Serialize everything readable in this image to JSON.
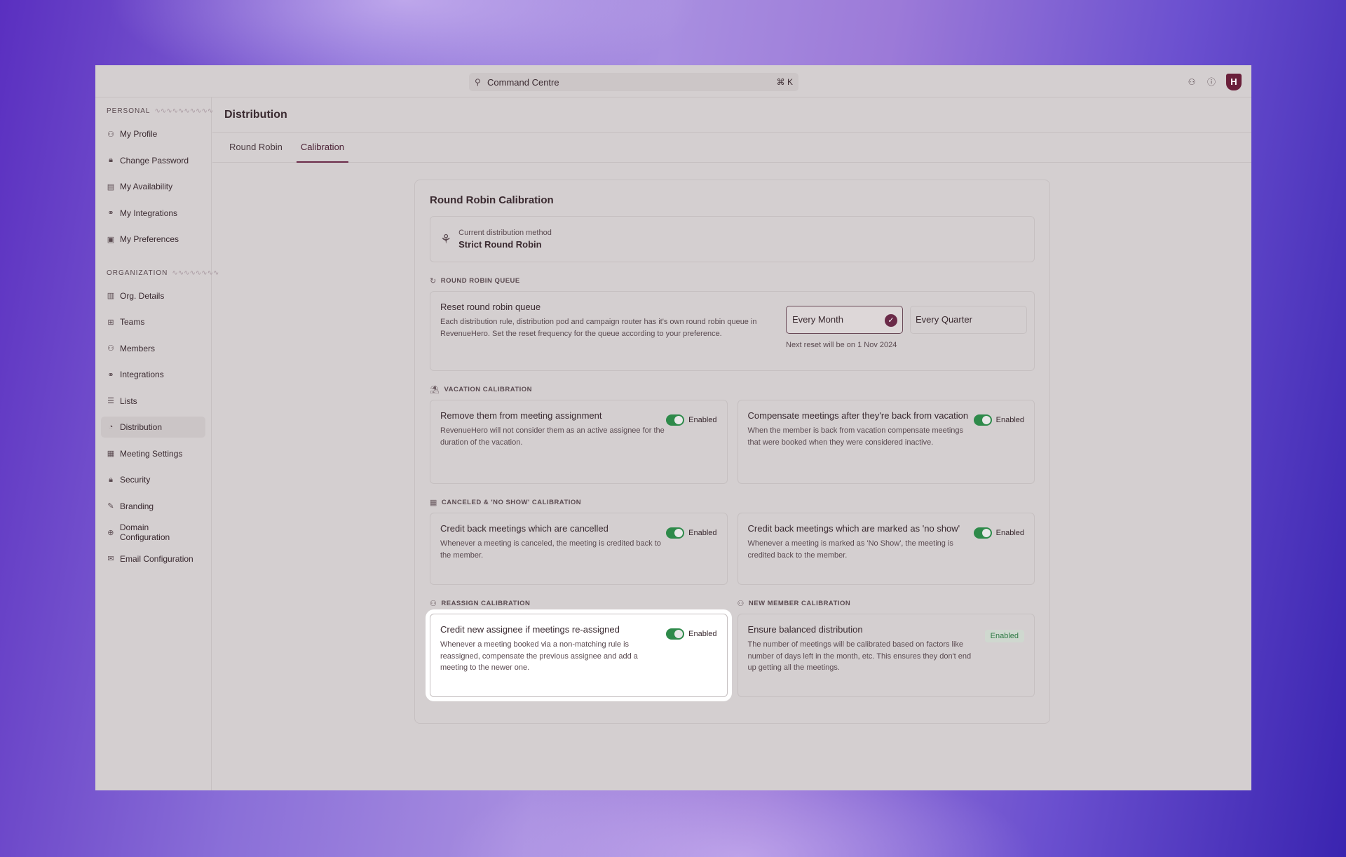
{
  "search": {
    "label": "Command Centre",
    "shortcut": "⌘ K"
  },
  "header": {
    "logo_text": "H"
  },
  "sidebar": {
    "personal_title": "PERSONAL",
    "organization_title": "ORGANIZATION",
    "personal_items": [
      {
        "label": "My Profile",
        "icon": "user-icon"
      },
      {
        "label": "Change Password",
        "icon": "lock-icon"
      },
      {
        "label": "My Availability",
        "icon": "calendar-icon"
      },
      {
        "label": "My Integrations",
        "icon": "plug-icon"
      },
      {
        "label": "My Preferences",
        "icon": "preferences-icon"
      }
    ],
    "org_items": [
      {
        "label": "Org. Details",
        "icon": "building-icon"
      },
      {
        "label": "Teams",
        "icon": "teams-icon"
      },
      {
        "label": "Members",
        "icon": "members-icon"
      },
      {
        "label": "Integrations",
        "icon": "plug-icon"
      },
      {
        "label": "Lists",
        "icon": "list-icon"
      },
      {
        "label": "Distribution",
        "icon": "distribution-icon",
        "active": true
      },
      {
        "label": "Meeting Settings",
        "icon": "meeting-icon"
      },
      {
        "label": "Security",
        "icon": "lock-icon"
      },
      {
        "label": "Branding",
        "icon": "brush-icon"
      },
      {
        "label": "Domain Configuration",
        "icon": "globe-icon"
      },
      {
        "label": "Email Configuration",
        "icon": "mail-icon"
      }
    ]
  },
  "main": {
    "title": "Distribution",
    "tabs": [
      {
        "label": "Round Robin",
        "active": false
      },
      {
        "label": "Calibration",
        "active": true
      }
    ]
  },
  "card": {
    "title": "Round Robin Calibration",
    "method_label": "Current distribution method",
    "method_value": "Strict Round Robin",
    "queue": {
      "group": "ROUND ROBIN QUEUE",
      "title": "Reset round robin queue",
      "desc": "Each distribution rule, distribution pod and campaign router has it's own round robin queue in RevenueHero. Set the reset frequency for the queue according to your preference.",
      "option_selected": "Every Month",
      "option_other": "Every Quarter",
      "next_reset": "Next reset will be on 1 Nov 2024"
    },
    "vacation": {
      "group": "VACATION CALIBRATION",
      "left_title": "Remove them from meeting assignment",
      "left_desc": "RevenueHero will not consider them as an active assignee for the duration of the vacation.",
      "left_status": "Enabled",
      "right_title": "Compensate meetings after they're back from vacation",
      "right_desc": "When the member is back from vacation compensate meetings that were booked when they were considered inactive.",
      "right_status": "Enabled"
    },
    "canceled": {
      "group": "CANCELED & 'NO SHOW' CALIBRATION",
      "left_title": "Credit back meetings which are cancelled",
      "left_desc": "Whenever a meeting is canceled, the meeting is credited back to the member.",
      "left_status": "Enabled",
      "right_title": "Credit back meetings which are marked as 'no show'",
      "right_desc": "Whenever a meeting is marked as 'No Show', the meeting is credited back to the member.",
      "right_status": "Enabled"
    },
    "reassign": {
      "group": "REASSIGN CALIBRATION",
      "title": "Credit new assignee if meetings re-assigned",
      "desc": "Whenever a meeting booked via a non-matching rule is reassigned, compensate the previous assignee and add a meeting to the newer one.",
      "status": "Enabled"
    },
    "new_member": {
      "group": "NEW MEMBER CALIBRATION",
      "title": "Ensure balanced distribution",
      "desc": "The number of meetings will be calibrated based on factors like number of days left in the month, etc. This ensures they don't end up getting all the meetings.",
      "status": "Enabled"
    }
  },
  "colors": {
    "toggle_on": "#2e8a4a",
    "accent": "#6a2a48",
    "highlight": "#ffffff"
  }
}
